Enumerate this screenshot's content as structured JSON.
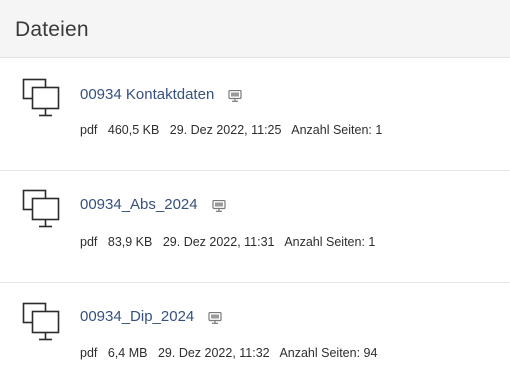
{
  "panel": {
    "title": "Dateien"
  },
  "icons": {
    "file_type_icon": "copy-monitor-icon",
    "open_icon": "monitor-icon"
  },
  "colors": {
    "link": "#36517e",
    "header_bg": "#f5f5f5",
    "divider": "#e6e6e6",
    "icon_stroke": "#2b2b2b",
    "monitor_icon": "#7a7a7a"
  },
  "files": [
    {
      "name": "00934 Kontaktdaten",
      "type": "pdf",
      "size": "460,5 KB",
      "date": "29. Dez 2022, 11:25",
      "pages": "Anzahl Seiten: 1"
    },
    {
      "name": "00934_Abs_2024",
      "type": "pdf",
      "size": "83,9 KB",
      "date": "29. Dez 2022, 11:31",
      "pages": "Anzahl Seiten: 1"
    },
    {
      "name": "00934_Dip_2024",
      "type": "pdf",
      "size": "6,4 MB",
      "date": "29. Dez 2022, 11:32",
      "pages": "Anzahl Seiten: 94"
    }
  ]
}
